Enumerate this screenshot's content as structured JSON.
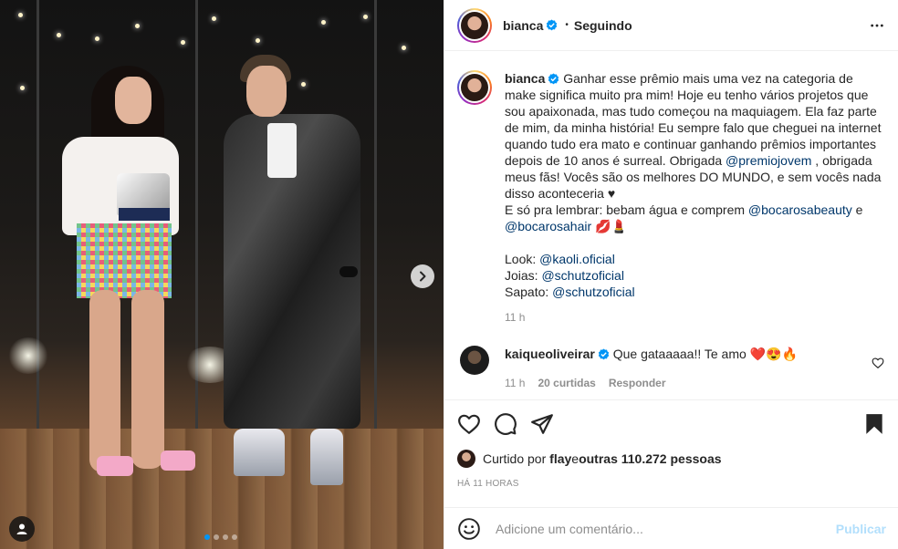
{
  "post": {
    "username": "bianca",
    "follow_status": "Seguindo",
    "separator": "•"
  },
  "caption": {
    "username": "bianca",
    "part1": "Ganhar esse prêmio mais uma vez na categoria de make significa muito pra mim! Hoje eu tenho vários projetos que sou apaixonada, mas tudo começou na maquiagem. Ela faz parte de mim, da minha história! Eu sempre falo que cheguei na internet quando tudo era mato e continuar ganhando prêmios importantes depois de 10 anos é surreal. Obrigada ",
    "mention1": "@premiojovem",
    "part2": " , obrigada meus fãs! Vocês são os melhores DO MUNDO, e sem vocês nada disso aconteceria ♥\nE só pra lembrar: bebam água e comprem ",
    "mention2": "@bocarosabeauty",
    "part3": " e ",
    "mention3": "@bocarosahair",
    "part4": " 💋💄\n\nLook: ",
    "mention4": "@kaoli.oficial",
    "part5": "\nJoias: ",
    "mention5": "@schutzoficial",
    "part6": "\nSapato: ",
    "mention6": "@schutzoficial",
    "time": "11 h"
  },
  "comment": {
    "username": "kaiqueoliveirar",
    "text": "Que gataaaaa!! Te amo ❤️😍🔥",
    "time": "11 h",
    "likes": "20 curtidas",
    "reply": "Responder"
  },
  "likes": {
    "prefix": "Curtido por ",
    "user": "flay",
    "middle": " e ",
    "others": "outras 110.272 pessoas"
  },
  "timestamp": "HÁ 11 HORAS",
  "add_comment": {
    "placeholder": "Adicione um comentário...",
    "publish": "Publicar"
  },
  "colors": {
    "verified": "#0095f6",
    "mention": "#00376b",
    "muted": "#8e8e8e",
    "publish_disabled": "#b2dffc"
  },
  "icons": [
    "more-icon",
    "verified-icon",
    "heart-icon",
    "comment-icon",
    "share-icon",
    "bookmark-icon",
    "emoji-icon",
    "next-arrow-icon",
    "user-tag-icon"
  ],
  "carousel": {
    "count": 4,
    "active": 1
  }
}
